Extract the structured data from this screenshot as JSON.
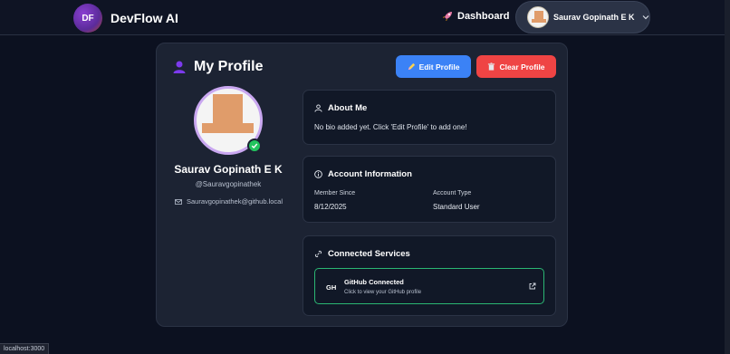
{
  "nav": {
    "logo_initials": "DF",
    "brand": "DevFlow AI",
    "dashboard_label": "Dashboard",
    "user_name": "Saurav Gopinath E K"
  },
  "profile": {
    "title": "My Profile",
    "edit_label": "Edit Profile",
    "clear_label": "Clear Profile",
    "name": "Saurav Gopinath E K",
    "handle": "@Sauravgopinathek",
    "email": "Sauravgopinathek@github.local"
  },
  "about": {
    "heading": "About Me",
    "bio": "No bio added yet. Click 'Edit Profile' to add one!"
  },
  "account": {
    "heading": "Account Information",
    "member_since_label": "Member Since",
    "member_since_value": "8/12/2025",
    "account_type_label": "Account Type",
    "account_type_value": "Standard User"
  },
  "services": {
    "heading": "Connected Services",
    "github_tag": "GH",
    "github_title": "GitHub Connected",
    "github_subtitle": "Click to view your GitHub profile"
  },
  "status_bar": "localhost:3000",
  "colors": {
    "background": "#0c1120",
    "card": "#1c2333",
    "edit_button": "#3b82f6",
    "clear_button": "#ef4444",
    "connected_border": "#2bb673",
    "verified": "#22c55e",
    "avatar_ring": "#c9a7f0"
  },
  "icons": [
    "rocket-icon",
    "chevron-down-icon",
    "user-icon",
    "pencil-icon",
    "trash-icon",
    "check-icon",
    "mail-icon",
    "info-icon",
    "link-icon",
    "external-link-icon"
  ]
}
